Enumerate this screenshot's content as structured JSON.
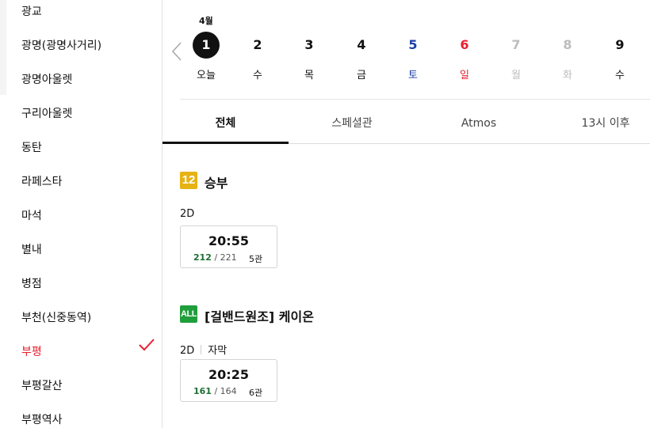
{
  "sidebar": {
    "items": [
      {
        "label": "광교"
      },
      {
        "label": "광명(광명사거리)"
      },
      {
        "label": "광명아울렛"
      },
      {
        "label": "구리아울렛"
      },
      {
        "label": "동탄"
      },
      {
        "label": "라페스타"
      },
      {
        "label": "마석"
      },
      {
        "label": "별내"
      },
      {
        "label": "병점"
      },
      {
        "label": "부천(신중동역)"
      },
      {
        "label": "부평",
        "selected": true
      },
      {
        "label": "부평갈산"
      },
      {
        "label": "부평역사"
      }
    ],
    "accent_color": "#e8202f"
  },
  "date_bar": {
    "month": "4월",
    "days": [
      {
        "num": "1",
        "dow": "오늘",
        "color": "black",
        "selected": true
      },
      {
        "num": "2",
        "dow": "수",
        "color": "black"
      },
      {
        "num": "3",
        "dow": "목",
        "color": "black"
      },
      {
        "num": "4",
        "dow": "금",
        "color": "black"
      },
      {
        "num": "5",
        "dow": "토",
        "color": "blue"
      },
      {
        "num": "6",
        "dow": "일",
        "color": "red"
      },
      {
        "num": "7",
        "dow": "월",
        "color": "gray"
      },
      {
        "num": "8",
        "dow": "화",
        "color": "gray"
      },
      {
        "num": "9",
        "dow": "수",
        "color": "black"
      }
    ]
  },
  "tabs": [
    {
      "label": "전체",
      "active": true
    },
    {
      "label": "스페셜관"
    },
    {
      "label": "Atmos"
    },
    {
      "label": "13시 이후"
    }
  ],
  "movies": [
    {
      "rating": "12",
      "title": "승부",
      "format": "2D",
      "subtitle": "",
      "showtimes": [
        {
          "time": "20:55",
          "available": "212",
          "total": "/ 221",
          "hall": "5관"
        }
      ]
    },
    {
      "rating": "ALL",
      "title": "[걸밴드원조] 케이온",
      "format": "2D",
      "subtitle": "자막",
      "showtimes": [
        {
          "time": "20:25",
          "available": "161",
          "total": "/ 164",
          "hall": "6관"
        }
      ]
    }
  ]
}
